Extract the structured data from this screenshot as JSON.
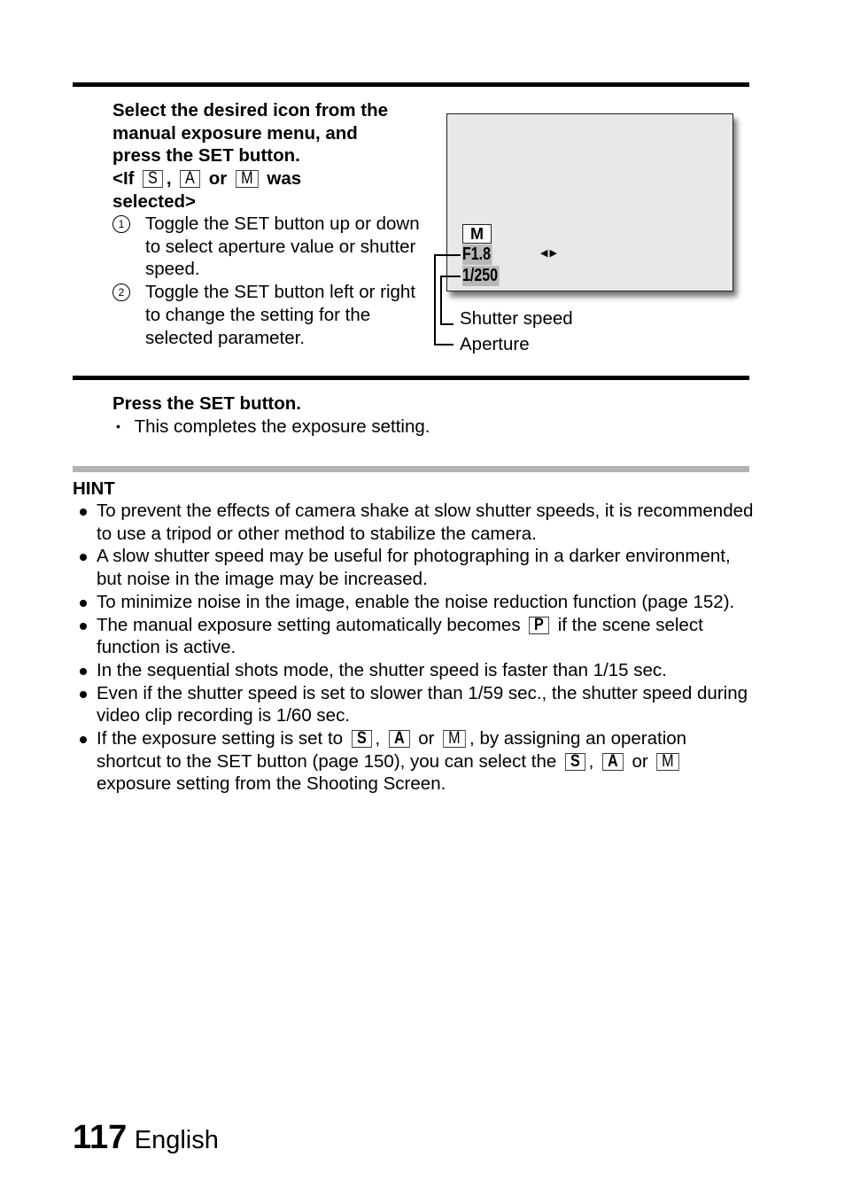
{
  "step1": {
    "title_lines": [
      "Select the desired icon from the",
      "manual exposure menu, and",
      "press the SET button."
    ],
    "condition_prefix": "<If",
    "condition_sep1": ",",
    "condition_or": "or",
    "condition_suffix": "was",
    "condition_line2": "selected>",
    "mode_icons": [
      "S",
      "A",
      "M"
    ],
    "sub_items": [
      {
        "marker": "1",
        "text": "Toggle the SET button up or down to select aperture value or shutter speed."
      },
      {
        "marker": "2",
        "text": "Toggle the SET button left or right to change the setting for the selected parameter."
      }
    ]
  },
  "screen": {
    "mode_icon": "M",
    "aperture_value": "F1.8",
    "shutter_value": "1/250",
    "arrows": "◀▶",
    "callouts": {
      "shutter": "Shutter speed",
      "aperture": "Aperture"
    }
  },
  "step2": {
    "title": "Press the SET button.",
    "bullet": "This completes the exposure setting."
  },
  "hint": {
    "title": "HINT",
    "items": [
      "To prevent the effects of camera shake at slow shutter speeds, it is recommended to use a tripod or other method to stabilize the camera.",
      "A slow shutter speed may be useful for photographing in a darker environment, but noise in the image may be increased.",
      "To minimize noise in the image, enable the noise reduction function (page 152)."
    ],
    "item4_pre": "The manual exposure setting automatically becomes",
    "item4_icon": "P",
    "item4_post": "if the scene select function is active.",
    "item5": "In the sequential shots mode, the shutter speed is faster than 1/15 sec.",
    "item6": "Even if the shutter speed is set to slower than 1/59 sec., the shutter speed during video clip recording is 1/60 sec.",
    "item7_a": "If the exposure setting is set to",
    "item7_b": ", by assigning an operation shortcut to the SET button (page 150), you can select the",
    "item7_c": "exposure setting from the Shooting Screen.",
    "comma": ",",
    "or": "or",
    "icons": [
      "S",
      "A",
      "M"
    ]
  },
  "footer": {
    "page_number": "117",
    "language": "English"
  }
}
